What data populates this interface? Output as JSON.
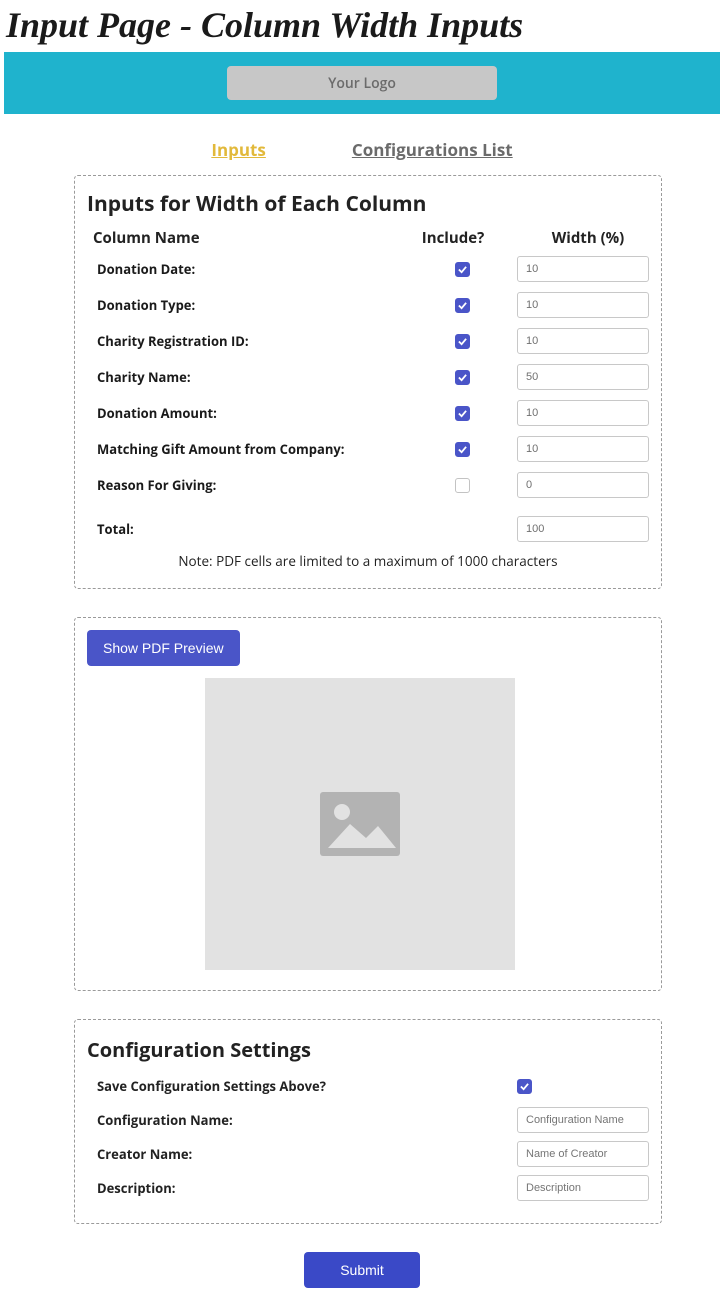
{
  "title": "Input Page - Column Width Inputs",
  "logo_text": "Your Logo",
  "tabs": {
    "inputs": "Inputs",
    "configs": "Configurations List"
  },
  "section1": {
    "heading": "Inputs for Width of Each Column",
    "headers": {
      "name": "Column Name",
      "include": "Include?",
      "width": "Width (%)"
    },
    "rows": [
      {
        "label": "Donation Date:",
        "include": true,
        "width_value": "10"
      },
      {
        "label": "Donation Type:",
        "include": true,
        "width_value": "10"
      },
      {
        "label": "Charity Registration ID:",
        "include": true,
        "width_value": "10"
      },
      {
        "label": "Charity Name:",
        "include": true,
        "width_value": "50"
      },
      {
        "label": "Donation Amount:",
        "include": true,
        "width_value": "10"
      },
      {
        "label": "Matching Gift Amount from Company:",
        "include": true,
        "width_value": "10"
      },
      {
        "label": "Reason For Giving:",
        "include": false,
        "width_value": "0"
      }
    ],
    "total": {
      "label": "Total:",
      "value": "100"
    },
    "note": "Note: PDF cells are limited to a maximum of 1000 characters"
  },
  "section2": {
    "button": "Show PDF Preview"
  },
  "section3": {
    "heading": "Configuration Settings",
    "save": {
      "label": "Save Configuration Settings Above?",
      "checked": true
    },
    "name": {
      "label": "Configuration Name:",
      "placeholder": "Configuration Name"
    },
    "creator": {
      "label": "Creator Name:",
      "placeholder": "Name of Creator"
    },
    "desc": {
      "label": "Description:",
      "placeholder": "Description"
    }
  },
  "submit_label": "Submit"
}
